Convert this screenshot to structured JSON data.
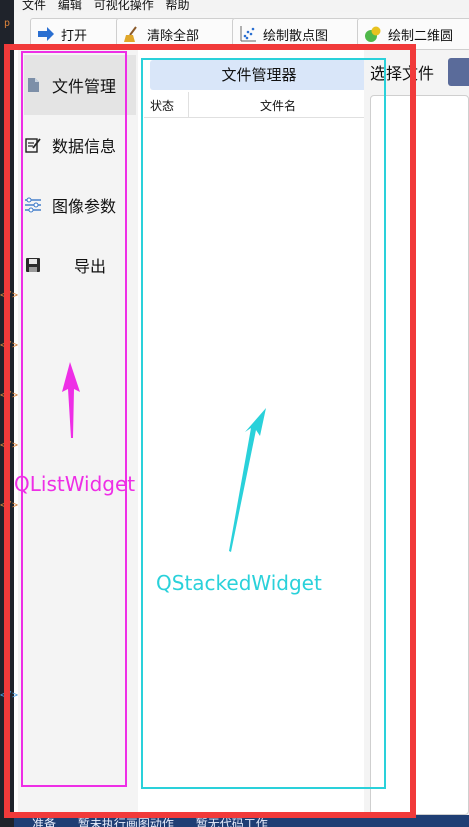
{
  "menubar": {
    "items": [
      "文件",
      "编辑",
      "可视化操作",
      "帮助"
    ]
  },
  "toolbar": {
    "buttons": [
      {
        "label": "打开",
        "icon": "open-arrow-icon"
      },
      {
        "label": "清除全部",
        "icon": "broom-icon"
      },
      {
        "label": "绘制散点图",
        "icon": "scatter-plot-icon"
      },
      {
        "label": "绘制二维圆",
        "icon": "color-circles-icon"
      }
    ]
  },
  "list_widget": {
    "items": [
      {
        "label": "文件管理",
        "icon": "document-icon",
        "selected": true
      },
      {
        "label": "数据信息",
        "icon": "edit-document-icon",
        "selected": false
      },
      {
        "label": "图像参数",
        "icon": "sliders-icon",
        "selected": false
      },
      {
        "label": "导出",
        "icon": "save-disk-icon",
        "selected": false
      }
    ]
  },
  "file_manager": {
    "title": "文件管理器",
    "columns": [
      "状态",
      "文件名"
    ]
  },
  "right_panel": {
    "label": "选择文件"
  },
  "status_bar": {
    "items": [
      "准备",
      "暂未执行画图动作",
      "暂无代码工作"
    ]
  },
  "annotations": {
    "list_widget_label": "QListWidget",
    "stacked_widget_label": "QStackedWidget",
    "outer_color": "#f13a3a",
    "list_color": "#ee2ee6",
    "stack_color": "#2ad1da"
  },
  "colors": {
    "selected_item_bg": "#e4e4e4",
    "title_bg": "#d9e6f9",
    "status_bar_bg": "#1f3e74"
  }
}
